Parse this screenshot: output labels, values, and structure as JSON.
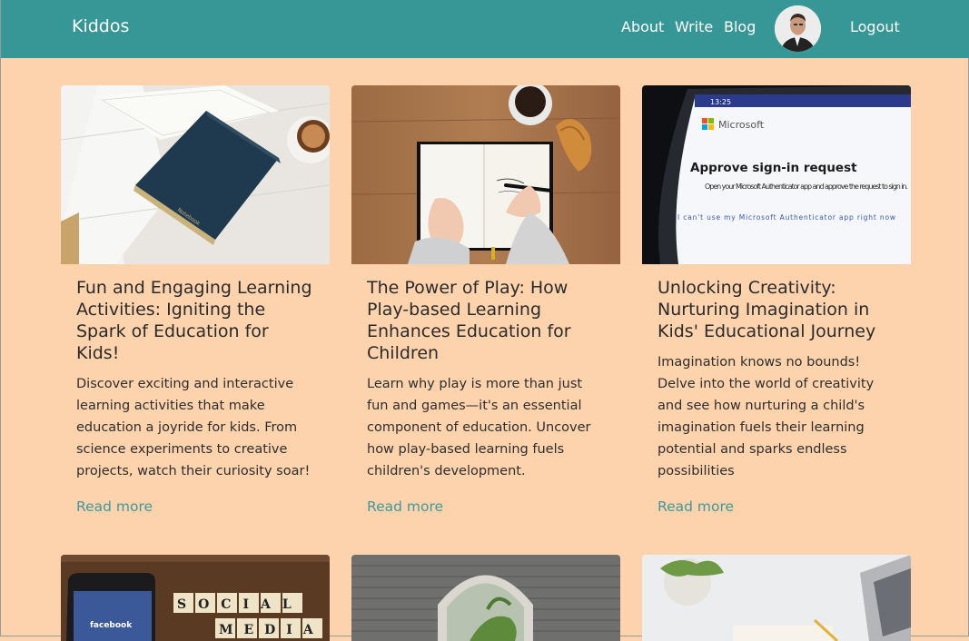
{
  "navbar": {
    "brand": "Kiddos",
    "links": [
      "About",
      "Write",
      "Blog"
    ],
    "logout": "Logout"
  },
  "cards": [
    {
      "title": "Fun and Engaging Learning Activities: Igniting the Spark of Education for Kids!",
      "text": "Discover exciting and interactive learning activities that make education a joyride for kids. From science experiments to creative projects, watch their curiosity soar!",
      "link": "Read more"
    },
    {
      "title": "The Power of Play: How Play-based Learning Enhances Education for Children",
      "text": "Learn why play is more than just fun and games—it's an essential component of education. Uncover how play-based learning fuels children's development.",
      "link": "Read more"
    },
    {
      "title": "Unlocking Creativity: Nurturing Imagination in Kids' Educational Journey",
      "text": "Imagination knows no bounds! Delve into the world of creativity and see how nurturing a child's imagination fuels their learning potential and sparks endless possibilities",
      "link": "Read more"
    }
  ],
  "images": {
    "phone_brand": "Microsoft",
    "phone_heading": "Approve sign-in request",
    "phone_text": "Open your Microsoft Authenticator app and approve the request to sign in.",
    "phone_link": "I can't use my Microsoft Authenticator app right now",
    "phone_time": "13:25",
    "notebook_label": "Notebook",
    "fb_label": "facebook",
    "tiles_row1": "SOCIAL",
    "tiles_row2": "MEDIA"
  }
}
